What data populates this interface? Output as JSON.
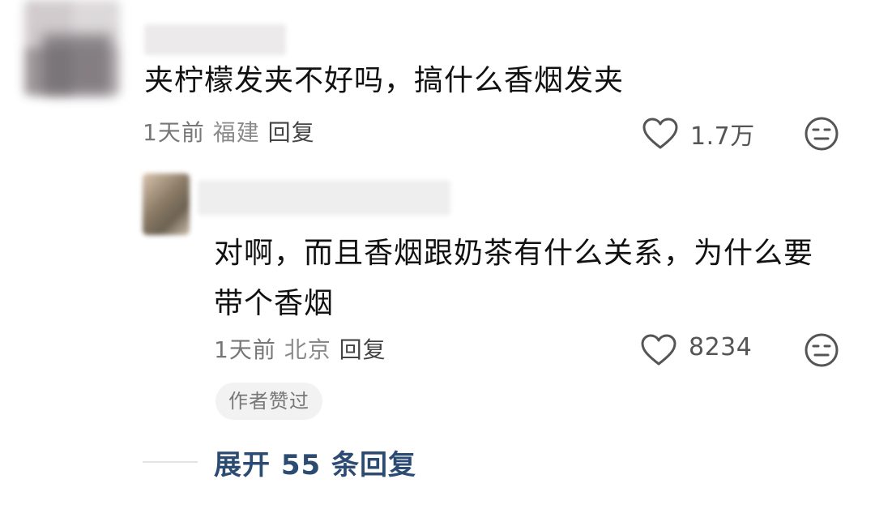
{
  "comment_1": {
    "text": "夹柠檬发夹不好吗，搞什么香烟发夹",
    "time": "1天前",
    "location": "福建",
    "reply_label": "回复",
    "like_count": "1.7万"
  },
  "comment_2": {
    "text": "对啊，而且香烟跟奶茶有什么关系，为什么要带个香烟",
    "time": "1天前",
    "location": "北京",
    "reply_label": "回复",
    "like_count": "8234",
    "badge": "作者赞过"
  },
  "expand_replies": "展开 55 条回复",
  "icons": {
    "like": "heart-outline-icon",
    "dislike": "meh-face-icon"
  },
  "colors": {
    "text": "#111111",
    "meta": "#777777",
    "link": "#2b4b73",
    "badge_bg": "#f2f2f2"
  }
}
